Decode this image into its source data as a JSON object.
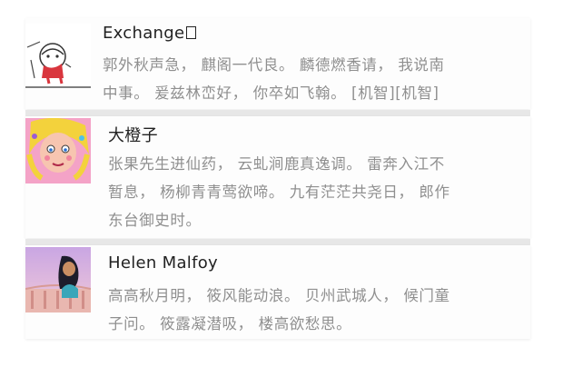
{
  "comments": [
    {
      "name": "Exchange",
      "name_suffix_icon": "broken-glyph-square",
      "lines": [
        "郭外秋声急， 麒阁一代良。 麟德燃香请， 我说南",
        "中事。 爰兹林峦好， 你卒如飞翰。 [机智][机智]"
      ],
      "avatar": "sketch-character-avatar"
    },
    {
      "name": "大橙子",
      "lines": [
        "张果先生进仙药， 云虬涧鹿真逸调。 雷奔入江不",
        "暂息， 杨柳青青莺欲啼。 九有茫茫共尧日， 郎作",
        "东台御史时。"
      ],
      "avatar": "cartoon-girl-avatar"
    },
    {
      "name": "Helen Malfoy",
      "lines": [
        "高高秋月明， 筱风能动浪。 贝州武城人， 候门童",
        "子问。 筱露凝潜吸， 楼高欲愁思。"
      ],
      "avatar": "princess-cartoon-avatar"
    }
  ]
}
